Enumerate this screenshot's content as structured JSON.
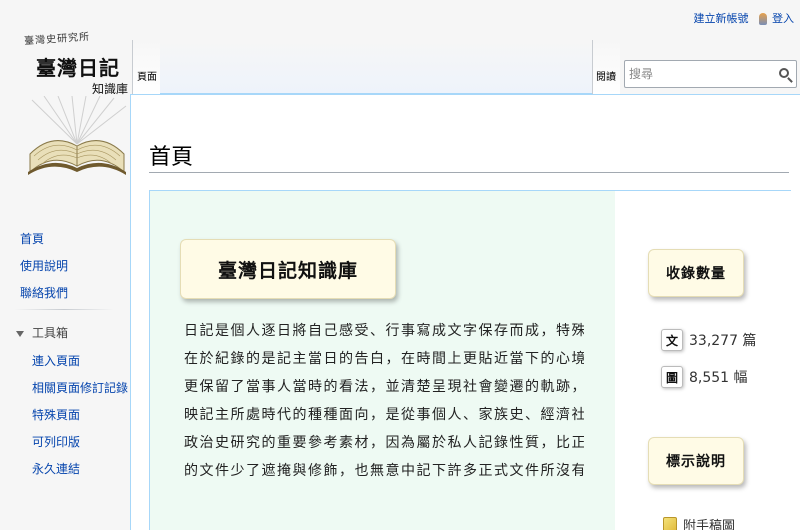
{
  "logo": {
    "subtitle": "臺灣史研究所",
    "title": "臺灣日記",
    "side_text": "知識庫"
  },
  "personal": {
    "create_account": "建立新帳號",
    "login": "登入"
  },
  "tabs": {
    "page": "頁面",
    "read": "閱讀"
  },
  "search": {
    "placeholder": "搜尋"
  },
  "heading": "首頁",
  "main": {
    "title": "臺灣日記知識庫",
    "intro_lines": [
      "日記是個人逐日將自己感受、行事寫成文字保存而成，特殊性",
      "在於紀錄的是記主當日的告白，在時間上更貼近當下的心境，",
      "更保留了當事人當時的看法，並清楚呈現社會變遷的軌跡，反",
      "映記主所處時代的種種面向，是從事個人、家族史、經濟社會",
      "政治史研究的重要參考素材，因為屬於私人記錄性質，比正式",
      "的文件少了遮掩與修飾，也無意中記下許多正式文件所沒有的"
    ]
  },
  "stats": {
    "heading": "收錄數量",
    "articles_badge": "文",
    "articles_value": "33,277 篇",
    "images_badge": "圖",
    "images_value": "8,551 幅"
  },
  "legend": {
    "heading": "標示說明",
    "item": "附手稿圖"
  },
  "nav": {
    "items": [
      "首頁",
      "使用說明",
      "聯絡我們"
    ]
  },
  "tools": {
    "header": "工具箱",
    "items": [
      "連入頁面",
      "相關頁面修訂記錄",
      "特殊頁面",
      "可列印版",
      "永久連結"
    ]
  }
}
